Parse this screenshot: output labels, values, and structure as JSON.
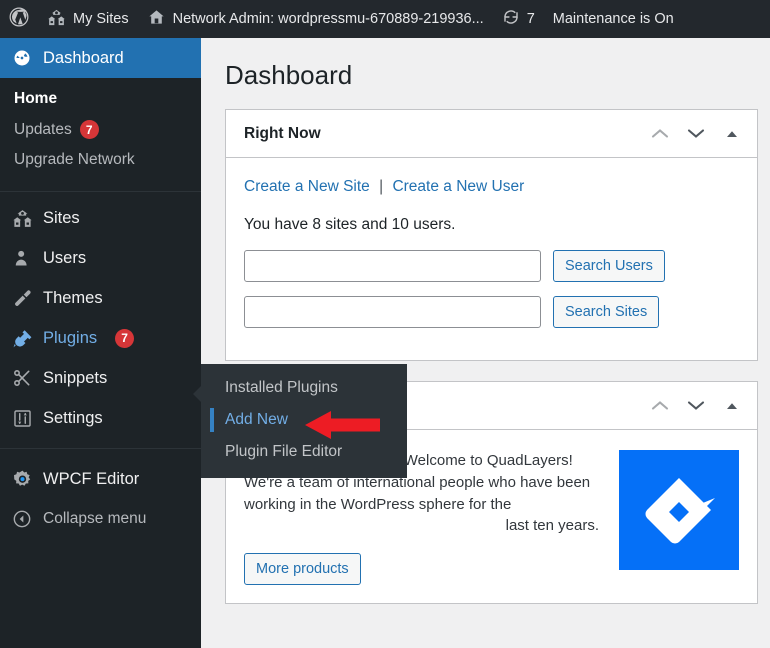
{
  "adminbar": {
    "wp_logo_icon": "wordpress-logo-icon",
    "my_sites_icon": "sites-buildings-icon",
    "my_sites_label": "My Sites",
    "network_home_icon": "house-icon",
    "network_label": "Network Admin: wordpressmu-670889-219936...",
    "updates_icon": "update-arrows-icon",
    "updates_count": "7",
    "maintenance_label": "Maintenance is On"
  },
  "sidebar": {
    "current": {
      "label": "Dashboard",
      "icon": "dashboard-gauge-icon"
    },
    "dashboard_submenu": [
      {
        "label": "Home",
        "current": true
      },
      {
        "label": "Updates",
        "badge": "7"
      },
      {
        "label": "Upgrade Network"
      }
    ],
    "items": [
      {
        "label": "Sites",
        "icon": "sites-buildings-icon"
      },
      {
        "label": "Users",
        "icon": "user-icon"
      },
      {
        "label": "Themes",
        "icon": "paintbrush-icon"
      },
      {
        "label": "Plugins",
        "icon": "plug-icon",
        "badge": "7",
        "hovered": true
      },
      {
        "label": "Snippets",
        "icon": "scissors-icon"
      },
      {
        "label": "Settings",
        "icon": "sliders-icon"
      },
      {
        "label": "WPCF Editor",
        "icon": "gear-icon"
      }
    ],
    "collapse": {
      "label": "Collapse menu",
      "icon": "collapse-left-icon"
    }
  },
  "flyout": {
    "items": [
      {
        "label": "Installed Plugins",
        "active": false
      },
      {
        "label": "Add New",
        "active": true
      },
      {
        "label": "Plugin File Editor",
        "active": false
      }
    ]
  },
  "annotation": {
    "arrow_icon": "red-arrow-left-icon",
    "arrow_color": "#ed1c24"
  },
  "main": {
    "page_title": "Dashboard",
    "right_now": {
      "title": "Right Now",
      "controls": {
        "up_icon": "chevron-up-icon",
        "down_icon": "chevron-down-icon",
        "toggle_icon": "triangle-up-icon"
      },
      "create_site_link": "Create a New Site",
      "link_separator": "|",
      "create_user_link": "Create a New User",
      "counts_text": "You have 8 sites and 10 users.",
      "search_users": {
        "value": "",
        "placeholder": "",
        "button_label": "Search Users"
      },
      "search_sites": {
        "value": "",
        "placeholder": "",
        "button_label": "Search Sites"
      }
    },
    "quadlayers": {
      "title": "",
      "controls": {
        "up_icon": "chevron-up-icon",
        "down_icon": "chevron-down-icon",
        "toggle_icon": "triangle-up-icon"
      },
      "body_text": "Hi! We are Quadlayers! Welcome to QuadLayers! We're a team of international people who have been working in the WordPress sphere for the",
      "body_last_line": "last ten years.",
      "button_label": "More products",
      "logo_icon": "quadlayers-logo-icon",
      "logo_color": "#0570f7"
    }
  }
}
